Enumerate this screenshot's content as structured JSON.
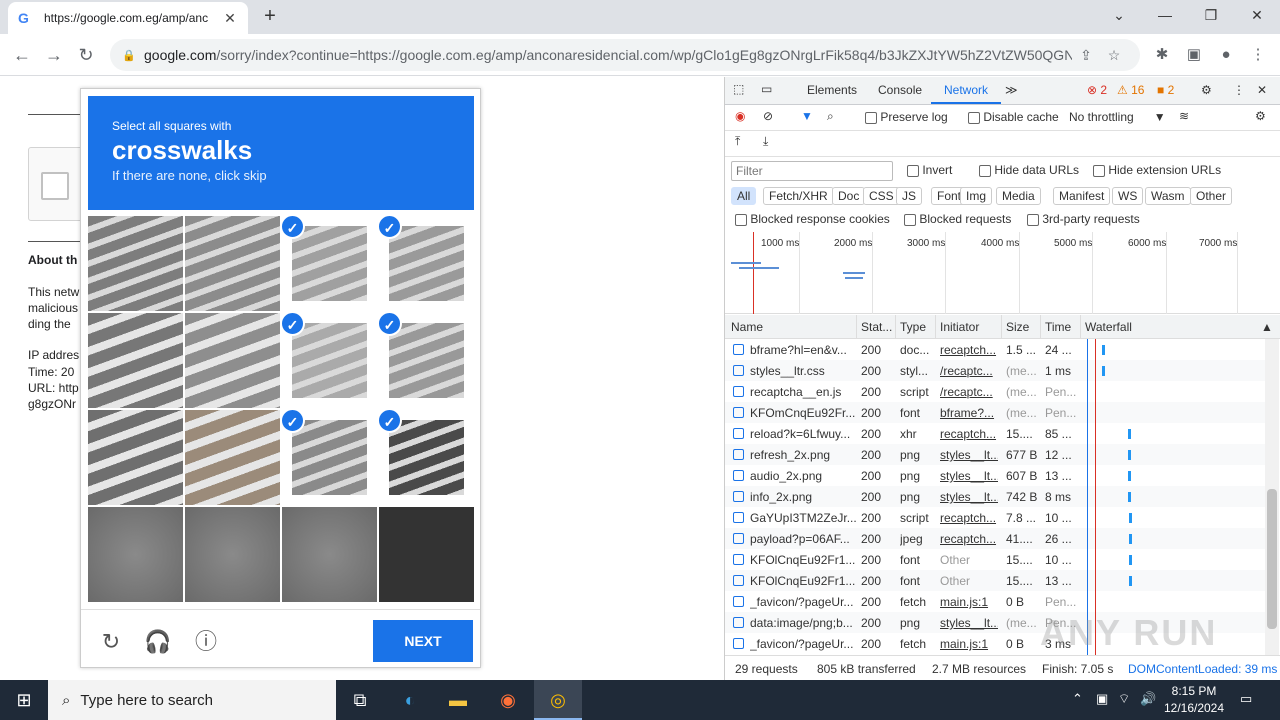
{
  "browser": {
    "tab_title": "https://google.com.eg/amp/anc",
    "url_host": "google.com",
    "url_path": "/sorry/index?continue=https://google.com.eg/amp/anconaresidencial.com/wp/gClo1gEg8gzONrgLrFik58q4/b3JkZXJtYW5hZ2VtZW50QGN..."
  },
  "page": {
    "about_heading": "About th",
    "lines": [
      "This netw",
      "malicious",
      "ding the",
      "IP addres",
      "Time: 20",
      "URL: http",
      "g8gzONr"
    ]
  },
  "captcha": {
    "line1": "Select all squares with",
    "keyword": "crosswalks",
    "line3": "If there are none, click skip",
    "next_label": "NEXT",
    "selected_tiles": [
      2,
      3,
      6,
      7,
      10,
      11
    ]
  },
  "devtools": {
    "tabs": [
      "Elements",
      "Console",
      "Network"
    ],
    "errors": "2",
    "warnings": "16",
    "issues": "2",
    "preserve_log": "Preserve log",
    "disable_cache": "Disable cache",
    "throttling": "No throttling",
    "filter_placeholder": "Filter",
    "invert": "Invert",
    "hide_data_urls": "Hide data URLs",
    "hide_ext_urls": "Hide extension URLs",
    "type_filters": [
      "All",
      "Fetch/XHR",
      "Doc",
      "CSS",
      "JS",
      "Font",
      "Img",
      "Media",
      "Manifest",
      "WS",
      "Wasm",
      "Other"
    ],
    "blocked_cookies": "Blocked response cookies",
    "blocked_requests": "Blocked requests",
    "third_party": "3rd-party requests",
    "ticks": [
      "1000 ms",
      "2000 ms",
      "3000 ms",
      "4000 ms",
      "5000 ms",
      "6000 ms",
      "7000 ms"
    ],
    "columns": [
      "Name",
      "Stat...",
      "Type",
      "Initiator",
      "Size",
      "Time",
      "Waterfall"
    ],
    "rows": [
      {
        "name": "bframe?hl=en&v...",
        "status": "200",
        "type": "doc...",
        "initiator": "recaptch...",
        "size": "1.5 ...",
        "time": "24 ..."
      },
      {
        "name": "styles__ltr.css",
        "status": "200",
        "type": "styl...",
        "initiator": "/recaptc...",
        "size": "(me...",
        "time": "1 ms"
      },
      {
        "name": "recaptcha__en.js",
        "status": "200",
        "type": "script",
        "initiator": "/recaptc...",
        "size": "(me...",
        "time": "Pen..."
      },
      {
        "name": "KFOmCnqEu92Fr...",
        "status": "200",
        "type": "font",
        "initiator": "bframe?...",
        "size": "(me...",
        "time": "Pen..."
      },
      {
        "name": "reload?k=6Lfwuy...",
        "status": "200",
        "type": "xhr",
        "initiator": "recaptch...",
        "size": "15....",
        "time": "85 ..."
      },
      {
        "name": "refresh_2x.png",
        "status": "200",
        "type": "png",
        "initiator": "styles__lt...",
        "size": "677 B",
        "time": "12 ..."
      },
      {
        "name": "audio_2x.png",
        "status": "200",
        "type": "png",
        "initiator": "styles__lt...",
        "size": "607 B",
        "time": "13 ..."
      },
      {
        "name": "info_2x.png",
        "status": "200",
        "type": "png",
        "initiator": "styles__lt...",
        "size": "742 B",
        "time": "8 ms"
      },
      {
        "name": "GaYUpI3TM2ZeJr...",
        "status": "200",
        "type": "script",
        "initiator": "recaptch...",
        "size": "7.8 ...",
        "time": "10 ..."
      },
      {
        "name": "payload?p=06AF...",
        "status": "200",
        "type": "jpeg",
        "initiator": "recaptch...",
        "size": "41....",
        "time": "26 ..."
      },
      {
        "name": "KFOlCnqEu92Fr1...",
        "status": "200",
        "type": "font",
        "initiator": "Other",
        "size": "15....",
        "time": "10 ..."
      },
      {
        "name": "KFOlCnqEu92Fr1...",
        "status": "200",
        "type": "font",
        "initiator": "Other",
        "size": "15....",
        "time": "13 ..."
      },
      {
        "name": "_favicon/?pageUr...",
        "status": "200",
        "type": "fetch",
        "initiator": "main.js:1",
        "size": "0 B",
        "time": "Pen..."
      },
      {
        "name": "data:image/png;b...",
        "status": "200",
        "type": "png",
        "initiator": "styles__lt...",
        "size": "(me...",
        "time": "Pen..."
      },
      {
        "name": "_favicon/?pageUr...",
        "status": "200",
        "type": "fetch",
        "initiator": "main.js:1",
        "size": "0 B",
        "time": "3 ms"
      }
    ],
    "status_requests": "29 requests",
    "status_transferred": "805 kB transferred",
    "status_resources": "2.7 MB resources",
    "status_finish": "Finish: 7.05 s",
    "status_dcl": "DOMContentLoaded: 39 ms"
  },
  "taskbar": {
    "search_placeholder": "Type here to search",
    "time": "8:15 PM",
    "date": "12/16/2024"
  },
  "watermark": "ANY RUN"
}
